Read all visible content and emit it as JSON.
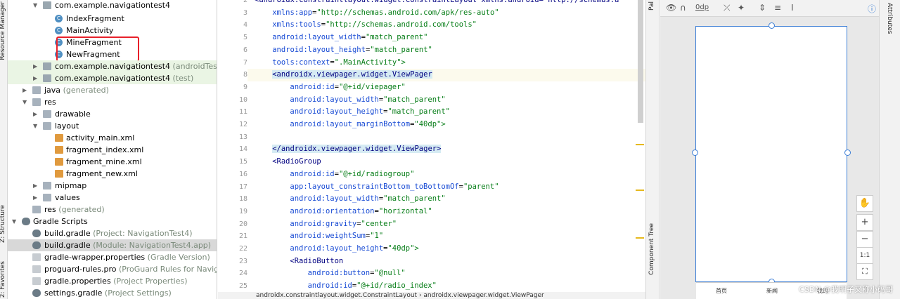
{
  "side_tabs": {
    "resource_manager": "Resource Manager",
    "structure": "Z: Structure",
    "favorites": "2: Favorites"
  },
  "tree": {
    "rows": [
      {
        "label": "com.example.navigationtest4",
        "sub": ""
      },
      {
        "label": "IndexFragment",
        "sub": ""
      },
      {
        "label": "MainActivity",
        "sub": ""
      },
      {
        "label": "MineFragment",
        "sub": ""
      },
      {
        "label": "NewFragment",
        "sub": ""
      },
      {
        "label": "com.example.navigationtest4",
        "sub": "(androidTest)"
      },
      {
        "label": "com.example.navigationtest4",
        "sub": "(test)"
      },
      {
        "label": "java",
        "sub": "(generated)"
      },
      {
        "label": "res",
        "sub": ""
      },
      {
        "label": "drawable",
        "sub": ""
      },
      {
        "label": "layout",
        "sub": ""
      },
      {
        "label": "activity_main.xml",
        "sub": ""
      },
      {
        "label": "fragment_index.xml",
        "sub": ""
      },
      {
        "label": "fragment_mine.xml",
        "sub": ""
      },
      {
        "label": "fragment_new.xml",
        "sub": ""
      },
      {
        "label": "mipmap",
        "sub": ""
      },
      {
        "label": "values",
        "sub": ""
      },
      {
        "label": "res",
        "sub": "(generated)"
      },
      {
        "label": "Gradle Scripts",
        "sub": ""
      },
      {
        "label": "build.gradle",
        "sub": "(Project: NavigationTest4)"
      },
      {
        "label": "build.gradle",
        "sub": "(Module: NavigationTest4.app)"
      },
      {
        "label": "gradle-wrapper.properties",
        "sub": "(Gradle Version)"
      },
      {
        "label": "proguard-rules.pro",
        "sub": "(ProGuard Rules for Navigation"
      },
      {
        "label": "gradle.properties",
        "sub": "(Project Properties)"
      },
      {
        "label": "settings.gradle",
        "sub": "(Project Settings)"
      }
    ]
  },
  "editor": {
    "line_numbers": [
      "2",
      "3",
      "4",
      "5",
      "6",
      "7",
      "8",
      "9",
      "10",
      "11",
      "12",
      "13",
      "14",
      "15",
      "16",
      "17",
      "18",
      "19",
      "20",
      "21",
      "22",
      "23",
      "24",
      "25"
    ],
    "lines": [
      {
        "t": "<androidx.constraintlayout.widget.ConstraintLayout xmlns:android=\"http://schemas.a"
      },
      {
        "a": "xmlns:app",
        "v": "\"http://schemas.android.com/apk/res-auto\""
      },
      {
        "a": "xmlns:tools",
        "v": "\"http://schemas.android.com/tools\""
      },
      {
        "a": "android:layout_width",
        "v": "\"match_parent\""
      },
      {
        "a": "android:layout_height",
        "v": "\"match_parent\""
      },
      {
        "a": "tools:context",
        "v": "\".MainActivity\">"
      },
      {
        "t": "<androidx.viewpager.widget.ViewPager"
      },
      {
        "a": "android:id",
        "v": "\"@+id/viepager\""
      },
      {
        "a": "android:layout_width",
        "v": "\"match_parent\""
      },
      {
        "a": "android:layout_height",
        "v": "\"match_parent\""
      },
      {
        "a": "android:layout_marginBottom",
        "v": "\"40dp\">"
      },
      {},
      {
        "t": "</androidx.viewpager.widget.ViewPager>"
      },
      {
        "t": "<RadioGroup"
      },
      {
        "a": "android:id",
        "v": "\"@+id/radiogroup\""
      },
      {
        "a": "app:layout_constraintBottom_toBottomOf",
        "v": "\"parent\""
      },
      {
        "a": "android:layout_width",
        "v": "\"match_parent\""
      },
      {
        "a": "android:orientation",
        "v": "\"horizontal\""
      },
      {
        "a": "android:gravity",
        "v": "\"center\""
      },
      {
        "a": "android:weightSum",
        "v": "\"1\""
      },
      {
        "a": "android:layout_height",
        "v": "\"40dp\">"
      },
      {
        "t": "<RadioButton"
      },
      {
        "a": "android:button",
        "v": "\"@null\""
      },
      {
        "a": "android:id",
        "v": "\"@+id/radio_index\""
      }
    ],
    "breadcrumb": "androidx.constraintlayout.widget.ConstraintLayout  ›  androidx.viewpager.widget.ViewPager"
  },
  "right_tabs": {
    "palette": "Pal",
    "component_tree": "Component Tree"
  },
  "design": {
    "margin": "0dp",
    "nav_labels": [
      "首页",
      "新闻",
      "我的"
    ],
    "zoom_fit": "1:1"
  },
  "attributes_tab": "Attributes",
  "watermark": "CSDN @我明子又称小码哥"
}
